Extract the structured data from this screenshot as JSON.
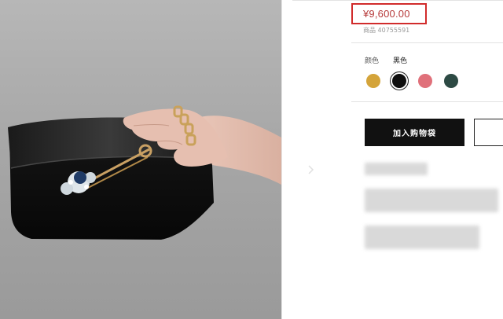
{
  "product": {
    "price": "¥9,600.00",
    "sku": "商品 40755591"
  },
  "color_selector": {
    "label": "颜色",
    "selected": "黑色",
    "swatches": [
      {
        "name": "yellow",
        "color": "#d4a43a"
      },
      {
        "name": "black",
        "color": "#0f0f0f",
        "selected": true
      },
      {
        "name": "pink",
        "color": "#e0707a"
      },
      {
        "name": "dark-green",
        "color": "#2d4a44"
      }
    ]
  },
  "actions": {
    "add_to_bag": "加入购物袋"
  },
  "colors": {
    "price_highlight": "#d12b2b",
    "button_bg": "#111111"
  },
  "icons": [
    "chevron-right-icon"
  ]
}
